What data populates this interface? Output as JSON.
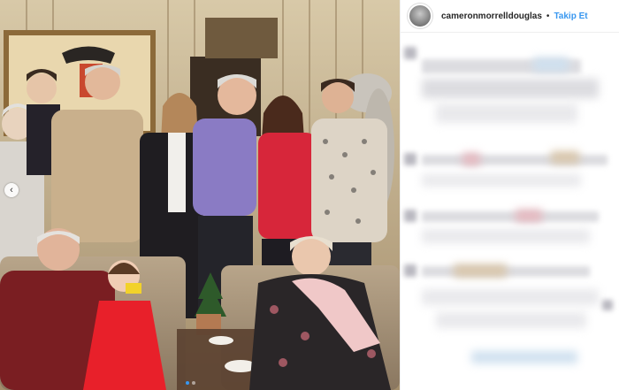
{
  "post": {
    "username": "cameronmorrelldouglas",
    "separator": "•",
    "follow_label": "Takip Et",
    "avatar_icon": "profile-avatar-icon",
    "accent_color": "#3897f0"
  },
  "photo": {
    "prev_icon": "chevron-left-icon",
    "prev_glyph": "‹",
    "carousel_count": 2,
    "carousel_active": 0
  }
}
